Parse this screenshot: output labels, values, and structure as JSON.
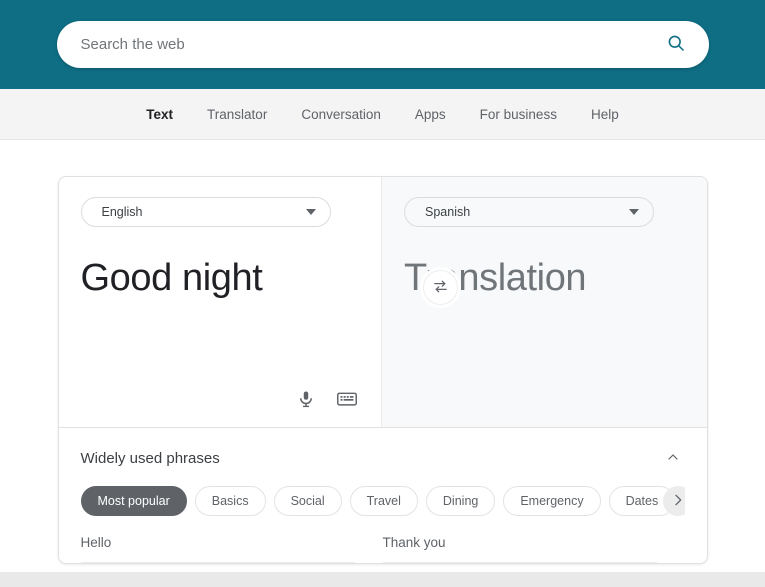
{
  "header": {
    "background_color": "#0f6e84",
    "search": {
      "placeholder": "Search the web",
      "value": "",
      "icon": "search-icon",
      "icon_color": "#0f6e84"
    }
  },
  "nav": {
    "items": [
      {
        "label": "Text",
        "active": true
      },
      {
        "label": "Translator",
        "active": false
      },
      {
        "label": "Conversation",
        "active": false
      },
      {
        "label": "Apps",
        "active": false
      },
      {
        "label": "For business",
        "active": false
      },
      {
        "label": "Help",
        "active": false
      }
    ]
  },
  "translator": {
    "source": {
      "language": "English",
      "text": "Good night",
      "is_placeholder": false,
      "tools": [
        {
          "icon": "microphone-icon",
          "name": "microphone-button"
        },
        {
          "icon": "keyboard-icon",
          "name": "keyboard-button"
        }
      ]
    },
    "target": {
      "language": "Spanish",
      "text": "Translation",
      "is_placeholder": true
    },
    "swap": {
      "icon": "swap-arrows-icon",
      "label": ""
    }
  },
  "phrases": {
    "title": "Widely used phrases",
    "collapse_icon": "chevron-up-icon",
    "next_icon": "chevron-right-icon",
    "categories": [
      {
        "label": "Most popular",
        "active": true
      },
      {
        "label": "Basics",
        "active": false
      },
      {
        "label": "Social",
        "active": false
      },
      {
        "label": "Travel",
        "active": false
      },
      {
        "label": "Dining",
        "active": false
      },
      {
        "label": "Emergency",
        "active": false
      },
      {
        "label": "Dates",
        "active": false
      }
    ],
    "columns": [
      {
        "items": [
          "Hello"
        ]
      },
      {
        "items": [
          "Thank you"
        ]
      }
    ]
  },
  "colors": {
    "accent_teal": "#0f6e84",
    "chip_active": "#5f6368",
    "target_pane_bg": "#f8f9fa",
    "nav_bg": "#f4f4f4"
  }
}
